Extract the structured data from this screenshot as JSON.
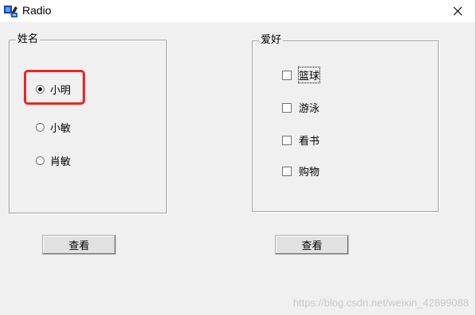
{
  "window": {
    "title": "Radio",
    "app_icon": "mfc-app-icon",
    "close_icon": "close-icon"
  },
  "name_group": {
    "label": "姓名",
    "options": [
      {
        "label": "小明",
        "checked": true
      },
      {
        "label": "小敏",
        "checked": false
      },
      {
        "label": "肖敏",
        "checked": false
      }
    ],
    "view_button": "查看"
  },
  "hobby_group": {
    "label": "爱好",
    "options": [
      {
        "label": "篮球",
        "checked": false
      },
      {
        "label": "游泳",
        "checked": false
      },
      {
        "label": "看书",
        "checked": false
      },
      {
        "label": "购物",
        "checked": false
      }
    ],
    "view_button": "查看"
  },
  "watermark": "https://blog.csdn.net/weixin_42899088",
  "colors": {
    "highlight": "#f02222",
    "window_bg": "#f0f0f0"
  }
}
